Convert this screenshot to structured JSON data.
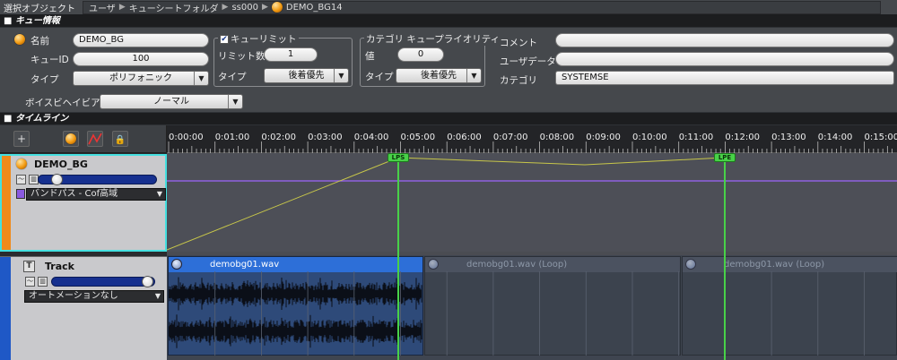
{
  "breadcrumb": {
    "label": "選択オブジェクト",
    "path": [
      "ユーザ",
      "キューシートフォルダ",
      "ss000",
      "DEMO_BG14"
    ]
  },
  "cue_info": {
    "section_title": "キュー情報",
    "name_label": "名前",
    "name_value": "DEMO_BG",
    "cue_id_label": "キューID",
    "cue_id_value": "100",
    "type_label": "タイプ",
    "type_value": "ポリフォニック",
    "cue_limit": {
      "title": "キューリミット",
      "checked": true,
      "limit_count_label": "リミット数",
      "limit_count_value": "1",
      "type_label": "タイプ",
      "type_value": "後着優先"
    },
    "category_priority": {
      "title": "カテゴリ キュープライオリティ",
      "value_label": "値",
      "value": "0",
      "type_label": "タイプ",
      "type_value": "後着優先"
    },
    "comment_label": "コメント",
    "comment_value": "",
    "user_data_label": "ユーザデータ",
    "user_data_value": "",
    "category_label": "カテゴリ",
    "category_value": "SYSTEMSE",
    "voice_behavior_label": "ボイスビヘイビア",
    "voice_behavior_value": "ノーマル"
  },
  "timeline": {
    "section_title": "タイムライン",
    "toolbar": {
      "add_glyph": "+",
      "lock_glyph": "🔒"
    },
    "ruler_ticks": [
      "0:00:00",
      "0:01:00",
      "0:02:00",
      "0:03:00",
      "0:04:00",
      "0:05:00",
      "0:06:00",
      "0:07:00",
      "0:08:00",
      "0:09:00",
      "0:10:00",
      "0:11:00",
      "0:12:00",
      "0:13:00",
      "0:14:00",
      "0:15:00"
    ],
    "markers": {
      "start": "LPS",
      "end": "LPE"
    },
    "tracks": [
      {
        "name": "DEMO_BG",
        "dropdown": "バンドパス - Cof高域",
        "volume": 0.12
      },
      {
        "name": "Track",
        "type_glyph": "T",
        "dropdown": "オートメーションなし",
        "volume": 0.97
      }
    ],
    "clips": [
      {
        "name": "demobg01.wav"
      },
      {
        "name": "demobg01.wav (Loop)"
      },
      {
        "name": "demobg01.wav (Loop)"
      }
    ]
  },
  "colors": {
    "accent_orange": "#f08a1a",
    "loop_green": "#48d148",
    "track_blue": "#1f58c6",
    "curve_purple": "#9060e0"
  }
}
